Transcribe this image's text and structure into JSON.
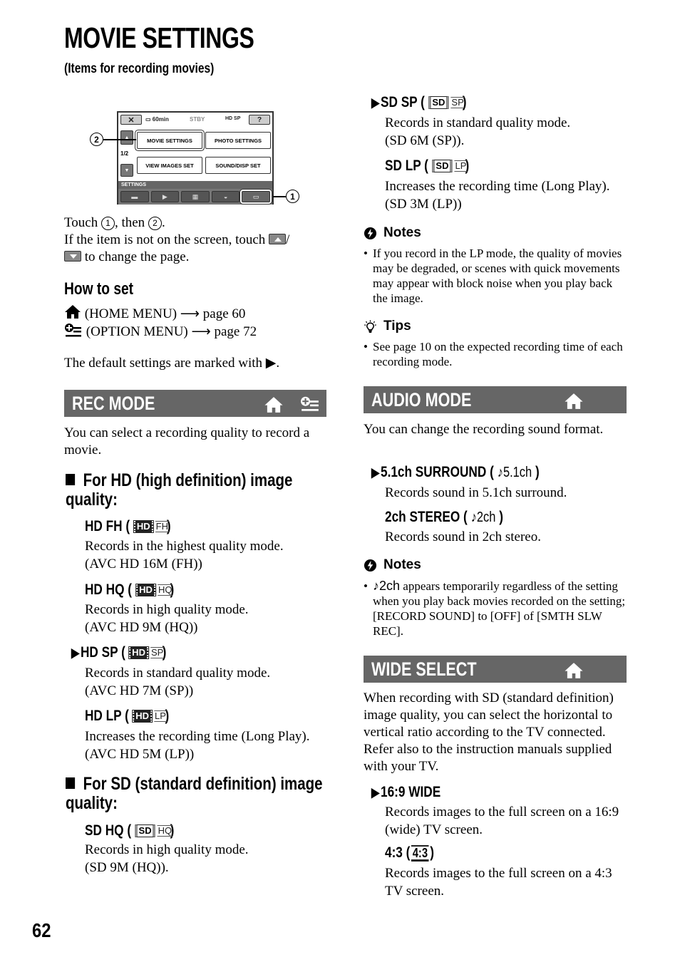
{
  "page": {
    "title": "MOVIE SETTINGS",
    "subtitle": "(Items for recording movies)",
    "page_number": "62"
  },
  "lcd": {
    "close": "✕",
    "battery": "60min",
    "status": "STBY",
    "quality": "HD SP",
    "help": "?",
    "page_indicator": "1/2",
    "menu_items": [
      "MOVIE SETTINGS",
      "PHOTO SETTINGS",
      "VIEW IMAGES SET",
      "SOUND/DISP SET"
    ],
    "settings_label": "SETTINGS",
    "callout_1": "1",
    "callout_2": "2"
  },
  "intro": {
    "touch_prefix": "Touch ",
    "touch_mid": ", then ",
    "touch_suffix": ".",
    "circle_1": "1",
    "circle_2": "2",
    "not_on_screen": "If the item is not on the screen, touch ",
    "slash": "/",
    "change_page": " to change the page."
  },
  "how_to_set": {
    "heading": "How to set",
    "home_menu": " (HOME MENU) ⟶ page 60",
    "option_menu": " (OPTION MENU) ⟶ page 72",
    "default_note": "The default settings are marked with ▶."
  },
  "rec_mode": {
    "title": "REC MODE",
    "intro": "You can select a recording quality to record a movie.",
    "hd_heading": "For HD (high definition) image quality:",
    "sd_heading": "For SD (standard definition) image quality:",
    "items": [
      {
        "label": "HD FH (",
        "icon_main": "HD",
        "icon_sub": "FH",
        "close": ")",
        "default": false,
        "desc1": "Records in the highest quality mode.",
        "desc2": "(AVC HD 16M (FH))"
      },
      {
        "label": "HD HQ (",
        "icon_main": "HD",
        "icon_sub": "HQ",
        "close": ")",
        "default": false,
        "desc1": "Records in high quality mode.",
        "desc2": "(AVC HD 9M (HQ))"
      },
      {
        "label": "HD SP (",
        "icon_main": "HD",
        "icon_sub": "SP",
        "close": ")",
        "default": true,
        "desc1": "Records in standard quality mode.",
        "desc2": "(AVC HD 7M (SP))"
      },
      {
        "label": "HD LP (",
        "icon_main": "HD",
        "icon_sub": "LP",
        "close": ")",
        "default": false,
        "desc1": "Increases the recording time (Long Play).",
        "desc2": "(AVC HD 5M (LP))"
      },
      {
        "label": "SD HQ (",
        "icon_main": "SD",
        "icon_sub": "HQ",
        "close": ")",
        "default": false,
        "desc1": "Records in high quality mode.",
        "desc2": "(SD 9M (HQ))."
      },
      {
        "label": "SD SP (",
        "icon_main": "SD",
        "icon_sub": "SP",
        "close": ")",
        "default": true,
        "desc1": "Records in standard quality mode.",
        "desc2": "(SD 6M (SP))."
      },
      {
        "label": "SD LP (",
        "icon_main": "SD",
        "icon_sub": "LP",
        "close": ")",
        "default": false,
        "desc1": "Increases the recording time (Long Play).",
        "desc2": "(SD 3M (LP))"
      }
    ],
    "notes_heading": "Notes",
    "notes": [
      "If you record in the LP mode, the quality of movies may be degraded, or scenes with quick movements may appear with block noise when you play back the image."
    ],
    "tips_heading": "Tips",
    "tips": [
      "See page 10 on the expected recording time of each recording mode."
    ]
  },
  "audio_mode": {
    "title": "AUDIO MODE",
    "intro": "You can change the recording sound format.",
    "items": [
      {
        "label": "5.1ch SURROUND (",
        "icon": "♪5.1ch",
        "close": ")",
        "default": true,
        "desc": "Records sound in 5.1ch surround."
      },
      {
        "label": "2ch STEREO (",
        "icon": "♪2ch",
        "close": ")",
        "default": false,
        "desc": "Records sound in 2ch stereo."
      }
    ],
    "notes_heading": "Notes",
    "note_icon": "♪2ch",
    "note_text": " appears temporarily regardless of the setting when you play back movies recorded on the setting; [RECORD SOUND] to [OFF] of [SMTH SLW REC]."
  },
  "wide_select": {
    "title": "WIDE SELECT",
    "intro": "When recording with SD (standard definition) image quality, you can select the horizontal to vertical ratio according to the TV connected. Refer also to the instruction manuals supplied with your TV.",
    "items": [
      {
        "label": "16:9 WIDE",
        "default": true,
        "desc": "Records images to the full screen on a 16:9 (wide) TV screen."
      },
      {
        "label": "4:3 (",
        "icon": "4:3",
        "close": ")",
        "default": false,
        "desc": "Records images to the full screen on a 4:3 TV screen."
      }
    ]
  },
  "colors": {
    "section_bar": "#666666",
    "text": "#000000"
  }
}
